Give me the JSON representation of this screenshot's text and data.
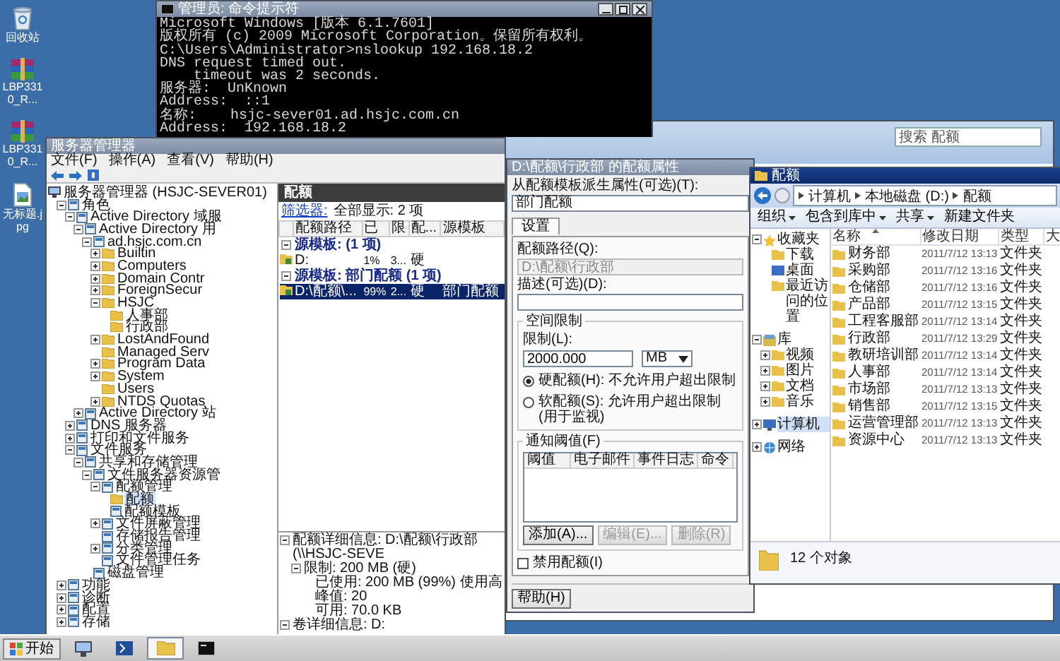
{
  "desktop_icons": [
    {
      "label": "回收站",
      "kind": "recycle-bin"
    },
    {
      "label": "LBP3310_R...",
      "kind": "archive"
    },
    {
      "label": "LBP3310_R...",
      "kind": "archive"
    },
    {
      "label": "无标题.jpg",
      "kind": "image"
    }
  ],
  "command_prompt": {
    "title": "管理员: 命令提示符",
    "blocks": [
      [
        "Microsoft Windows [版本 6.1.7601]",
        "版权所有 (c) 2009 Microsoft Corporation。保留所有权利。"
      ],
      [
        "C:\\Users\\Administrator>nslookup 192.168.18.2",
        "DNS request timed out.",
        "    timeout was 2 seconds.",
        "服务器:  UnKnown",
        "Address:  ::1"
      ],
      [
        "名称:    hsjc-sever01.ad.hsjc.com.cn",
        "Address:  192.168.18.2"
      ]
    ]
  },
  "background_window": {
    "search": {
      "placeholder": "搜索 配额"
    }
  },
  "server_manager": {
    "title": "服务器管理器",
    "menu": [
      "文件(F)",
      "操作(A)",
      "查看(V)",
      "帮助(H)"
    ],
    "tree": [
      {
        "label": "服务器管理器 (HSJC-SEVER01)",
        "kind": "server",
        "selected": false,
        "children": [
          {
            "label": "角色",
            "kind": "node",
            "expanded": true,
            "selected": false,
            "children": [
              {
                "label": "Active Directory 域服",
                "kind": "node",
                "expanded": true,
                "selected": false,
                "children": [
                  {
                    "label": "Active Directory 用",
                    "kind": "node",
                    "expanded": true,
                    "selected": false,
                    "children": [
                      {
                        "label": "ad.hsjc.com.cn",
                        "kind": "node",
                        "expanded": true,
                        "selected": false,
                        "children": [
                          {
                            "label": "Builtin",
                            "kind": "folder",
                            "expanded": false,
                            "selected": false
                          },
                          {
                            "label": "Computers",
                            "kind": "folder",
                            "expanded": false,
                            "selected": false
                          },
                          {
                            "label": "Domain Contr",
                            "kind": "folder",
                            "expanded": false,
                            "selected": false
                          },
                          {
                            "label": "ForeignSecur",
                            "kind": "folder",
                            "expanded": false,
                            "selected": false
                          },
                          {
                            "label": "HSJC",
                            "kind": "folder",
                            "expanded": true,
                            "selected": false,
                            "children": [
                              {
                                "label": "人事部",
                                "kind": "folder",
                                "selected": false
                              },
                              {
                                "label": "行政部",
                                "kind": "folder",
                                "selected": false
                              }
                            ]
                          },
                          {
                            "label": "LostAndFound",
                            "kind": "folder",
                            "expanded": false,
                            "selected": false
                          },
                          {
                            "label": "Managed Serv",
                            "kind": "folder",
                            "selected": false
                          },
                          {
                            "label": "Program Data",
                            "kind": "folder",
                            "expanded": false,
                            "selected": false
                          },
                          {
                            "label": "System",
                            "kind": "folder",
                            "expanded": false,
                            "selected": false
                          },
                          {
                            "label": "Users",
                            "kind": "folder",
                            "selected": false
                          },
                          {
                            "label": "NTDS Quotas",
                            "kind": "folder",
                            "expanded": false,
                            "selected": false
                          }
                        ]
                      }
                    ]
                  },
                  {
                    "label": "Active Directory 站",
                    "kind": "node",
                    "expanded": false,
                    "selected": false
                  }
                ]
              },
              {
                "label": "DNS 服务器",
                "kind": "node",
                "expanded": false,
                "selected": false
              },
              {
                "label": "打印和文件服务",
                "kind": "node",
                "expanded": false,
                "selected": false
              },
              {
                "label": "文件服务",
                "kind": "node",
                "expanded": true,
                "selected": false,
                "children": [
                  {
                    "label": "共享和存储管理",
                    "kind": "node",
                    "expanded": true,
                    "selected": false,
                    "children": [
                      {
                        "label": "文件服务器资源管",
                        "kind": "node",
                        "expanded": true,
                        "selected": false,
                        "children": [
                          {
                            "label": "配额管理",
                            "kind": "node",
                            "expanded": true,
                            "selected": false,
                            "children": [
                              {
                                "label": "配额",
                                "kind": "folder",
                                "selected": true
                              },
                              {
                                "label": "配额模板",
                                "kind": "node",
                                "selected": false
                              }
                            ]
                          },
                          {
                            "label": "文件屏蔽管理",
                            "kind": "node",
                            "expanded": false,
                            "selected": false
                          },
                          {
                            "label": "存储报告管理",
                            "kind": "node",
                            "selected": false
                          },
                          {
                            "label": "分类管理",
                            "kind": "node",
                            "expanded": false,
                            "selected": false
                          },
                          {
                            "label": "文件管理任务",
                            "kind": "node",
                            "selected": false
                          }
                        ]
                      },
                      {
                        "label": "磁盘管理",
                        "kind": "node",
                        "selected": false
                      }
                    ]
                  }
                ]
              }
            ]
          },
          {
            "label": "功能",
            "kind": "node",
            "expanded": false,
            "selected": false
          },
          {
            "label": "诊断",
            "kind": "node",
            "expanded": false,
            "selected": false
          },
          {
            "label": "配置",
            "kind": "node",
            "expanded": false,
            "selected": false
          },
          {
            "label": "存储",
            "kind": "node",
            "expanded": false,
            "selected": false
          }
        ]
      }
    ],
    "panel": {
      "title": "配额",
      "filter_link": "筛选器:",
      "filter_text": "全部显示: 2 项",
      "columns": [
        "配额路径",
        "已",
        "限",
        "配...",
        "源模板"
      ],
      "groups": [
        {
          "label": "源模板:  (1 项)",
          "expanded": true,
          "rows": [
            {
              "cells": [
                "D:",
                "1%",
                "3...",
                "硬"
              ],
              "selected": false
            }
          ]
        },
        {
          "label": "源模板: 部门配额 (1 项)",
          "expanded": true,
          "rows": [
            {
              "cells": [
                "D:\\配额\\...",
                "99%",
                "2...",
                "硬",
                "部门配额"
              ],
              "selected": true
            }
          ]
        }
      ],
      "details": [
        {
          "text": "配额详细信息: D:\\配额\\行政部 (\\\\HSJC-SEVE",
          "expanded": true,
          "children": [
            {
              "text": "限制: 200 MB (硬)",
              "expanded": true,
              "children": [
                {
                  "text": "已使用: 200 MB (99%) 使用高峰值: 20"
                },
                {
                  "text": "可用: 70.0 KB"
                }
              ]
            }
          ]
        },
        {
          "text": "卷详细信息: D:",
          "expanded": true
        }
      ]
    }
  },
  "quota_dialog": {
    "title": "D:\\配额\\行政部 的配额属性",
    "template_label": "从配额模板派生属性(可选)(T):",
    "template_value": "部门配额",
    "tabs": [
      {
        "label": "设置",
        "selected": true
      }
    ],
    "path_label": "配额路径(Q):",
    "path_value": "D:\\配额\\行政部",
    "path_disabled": true,
    "description_label": "描述(可选)(D):",
    "space_group": "空间限制",
    "limit_label": "限制(L):",
    "limit_value": "2000.000",
    "unit": "MB",
    "radios": [
      {
        "label": "硬配额(H): 不允许用户超出限制",
        "selected": true
      },
      {
        "label": "软配额(S): 允许用户超出限制(用于监视)",
        "selected": false
      }
    ],
    "notify_group": "通知阈值(F)",
    "notify_columns": [
      "阈值",
      "电子邮件",
      "事件日志",
      "命令"
    ],
    "buttons": [
      {
        "label": "添加(A)...",
        "disabled": false
      },
      {
        "label": "编辑(E)...",
        "disabled": true
      },
      {
        "label": "删除(R)",
        "disabled": true
      }
    ],
    "disable_checkbox": {
      "label": "禁用配额(I)",
      "checked": false
    },
    "help_button": "帮助(H)"
  },
  "explorer": {
    "title": "配额",
    "breadcrumb": [
      "计算机",
      "本地磁盘 (D:)",
      "配额"
    ],
    "toolbar": [
      {
        "label": "组织",
        "menu": true
      },
      {
        "label": "包含到库中",
        "menu": true
      },
      {
        "label": "共享",
        "menu": true
      },
      {
        "label": "新建文件夹",
        "menu": false
      }
    ],
    "nav": [
      {
        "label": "收藏夹",
        "kind": "star",
        "expanded": true,
        "selected": false,
        "children": [
          {
            "label": "下载",
            "kind": "folder",
            "selected": false
          },
          {
            "label": "桌面",
            "kind": "desktop",
            "selected": false
          },
          {
            "label": "最近访问的位置",
            "kind": "folder",
            "selected": false
          }
        ]
      },
      {
        "label": "库",
        "kind": "library",
        "expanded": true,
        "selected": false,
        "children": [
          {
            "label": "视频",
            "kind": "folder",
            "expanded": false,
            "selected": false
          },
          {
            "label": "图片",
            "kind": "folder",
            "expanded": false,
            "selected": false
          },
          {
            "label": "文档",
            "kind": "folder",
            "expanded": false,
            "selected": false
          },
          {
            "label": "音乐",
            "kind": "folder",
            "expanded": false,
            "selected": false
          }
        ]
      },
      {
        "label": "计算机",
        "kind": "computer",
        "expanded": false,
        "selected": true
      },
      {
        "label": "网络",
        "kind": "network",
        "expanded": false,
        "selected": false
      }
    ],
    "columns": [
      {
        "label": "名称",
        "sorted": true
      },
      {
        "label": "修改日期",
        "sorted": false
      },
      {
        "label": "类型",
        "sorted": false
      },
      {
        "label": "大",
        "sorted": false
      }
    ],
    "files": [
      {
        "name": "财务部",
        "date": "2011/7/12 13:13",
        "type": "文件夹",
        "selected": false
      },
      {
        "name": "采购部",
        "date": "2011/7/12 13:16",
        "type": "文件夹",
        "selected": false
      },
      {
        "name": "仓储部",
        "date": "2011/7/12 13:16",
        "type": "文件夹",
        "selected": false
      },
      {
        "name": "产品部",
        "date": "2011/7/12 13:15",
        "type": "文件夹",
        "selected": false
      },
      {
        "name": "工程客服部",
        "date": "2011/7/12 13:14",
        "type": "文件夹",
        "selected": false
      },
      {
        "name": "行政部",
        "date": "2011/7/12 13:29",
        "type": "文件夹",
        "selected": false
      },
      {
        "name": "教研培训部",
        "date": "2011/7/12 13:14",
        "type": "文件夹",
        "selected": false
      },
      {
        "name": "人事部",
        "date": "2011/7/12 13:14",
        "type": "文件夹",
        "selected": false
      },
      {
        "name": "市场部",
        "date": "2011/7/12 13:13",
        "type": "文件夹",
        "selected": false
      },
      {
        "name": "销售部",
        "date": "2011/7/12 13:15",
        "type": "文件夹",
        "selected": false
      },
      {
        "name": "运营管理部",
        "date": "2011/7/12 13:13",
        "type": "文件夹",
        "selected": false
      },
      {
        "name": "资源中心",
        "date": "2011/7/12 13:13",
        "type": "文件夹",
        "selected": false
      }
    ],
    "status": "12 个对象"
  },
  "taskbar": {
    "start": "开始",
    "buttons": [
      {
        "kind": "server-manager",
        "selected": false
      },
      {
        "kind": "powershell",
        "selected": false
      },
      {
        "kind": "explorer",
        "selected": true
      },
      {
        "kind": "console",
        "selected": false
      }
    ]
  }
}
